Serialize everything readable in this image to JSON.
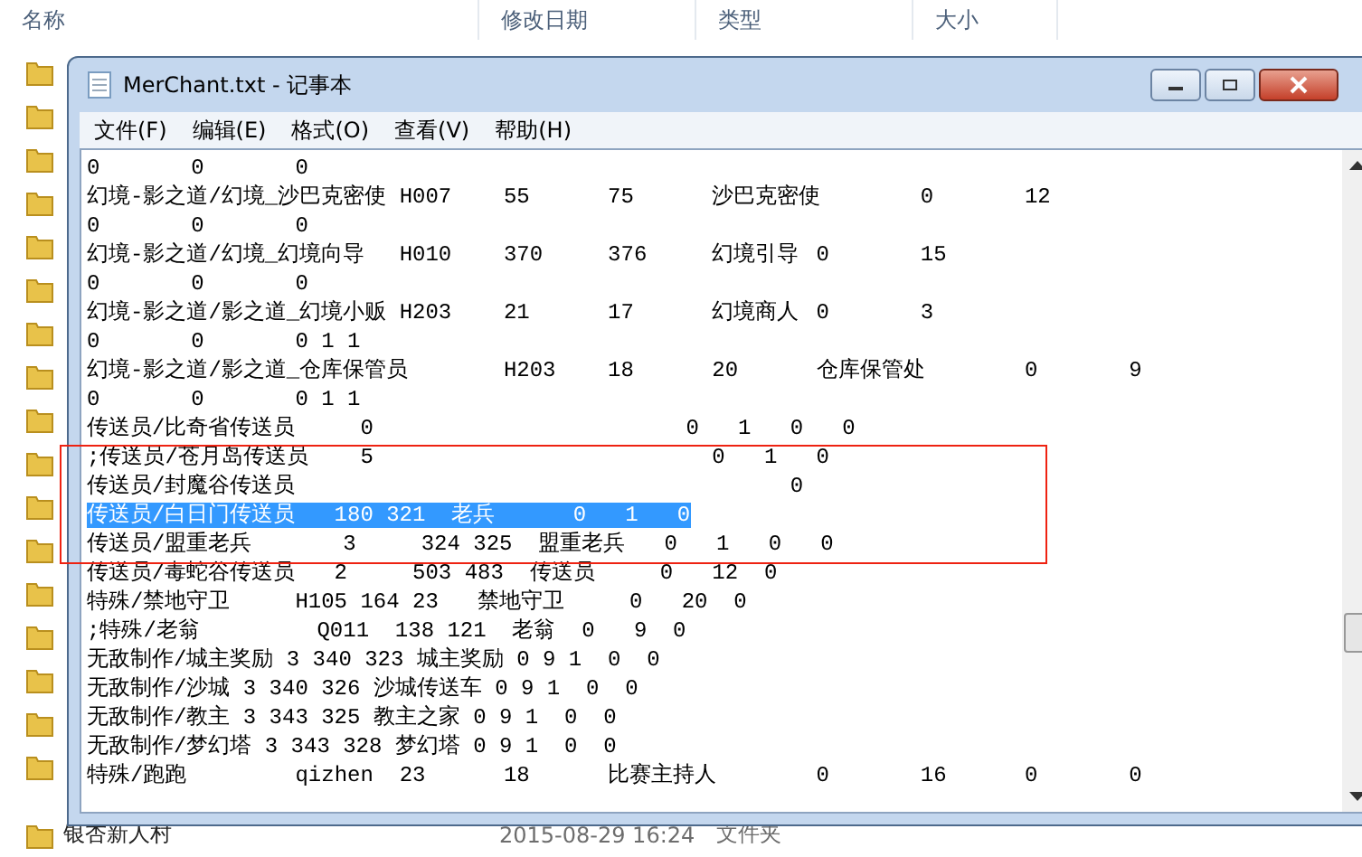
{
  "explorer": {
    "columns": [
      "名称",
      "修改日期",
      "类型",
      "大小"
    ],
    "rows": [
      {
        "name": "银杏新人村",
        "modified": "2015-08-29 16:24",
        "type": "文件夹"
      }
    ]
  },
  "window": {
    "title": "MerChant.txt - 记事本"
  },
  "menu": [
    "文件(F)",
    "编辑(E)",
    "格式(O)",
    "查看(V)",
    "帮助(H)"
  ],
  "lines": [
    {
      "text": "0\t0\t0",
      "selected": false
    },
    {
      "text": "幻境-影之道/幻境_沙巴克密使\tH007\t55\t75\t沙巴克密使\t0\t12",
      "selected": false
    },
    {
      "text": "0\t0\t0",
      "selected": false
    },
    {
      "text": "幻境-影之道/幻境_幻境向导\tH010\t370\t376\t幻境引导\t0\t15",
      "selected": false
    },
    {
      "text": "0\t0\t0",
      "selected": false
    },
    {
      "text": "幻境-影之道/影之道_幻境小贩\tH203\t21\t17\t幻境商人\t0\t3",
      "selected": false
    },
    {
      "text": "0\t0\t0 1 1",
      "selected": false
    },
    {
      "text": "幻境-影之道/影之道_仓库保管员\tH203\t18\t20\t仓库保管处\t0\t9",
      "selected": false
    },
    {
      "text": "0\t0\t0 1 1",
      "selected": false
    },
    {
      "text": "传送员/比奇省传送员     0                        0   1   0   0",
      "selected": false
    },
    {
      "text": ";传送员/苍月岛传送员    5                          0   1   0",
      "selected": false
    },
    {
      "text": "传送员/封魔谷传送员                                      0",
      "selected": false
    },
    {
      "text": "传送员/白日门传送员   180 321  老兵      0   1   0",
      "selected": true
    },
    {
      "text": "传送员/盟重老兵       3     324 325  盟重老兵   0   1   0   0",
      "selected": false
    },
    {
      "text": "传送员/毒蛇谷传送员   2     503 483  传送员     0   12  0",
      "selected": false
    },
    {
      "text": "特殊/禁地守卫     H105 164 23   禁地守卫     0   20  0",
      "selected": false
    },
    {
      "text": ";特殊/老翁         Q011  138 121  老翁  0   9  0",
      "selected": false
    },
    {
      "text": "无敌制作/城主奖励 3 340 323 城主奖励 0 9 1  0  0",
      "selected": false
    },
    {
      "text": "无敌制作/沙城 3 340 326 沙城传送车 0 9 1  0  0",
      "selected": false
    },
    {
      "text": "无敌制作/教主 3 343 325 教主之家 0 9 1  0  0",
      "selected": false
    },
    {
      "text": "无敌制作/梦幻塔 3 343 328 梦幻塔 0 9 1  0  0",
      "selected": false
    },
    {
      "text": "特殊/跑跑\tqizhen\t23\t18\t比赛主持人\t0\t16\t0\t0",
      "selected": false
    }
  ]
}
